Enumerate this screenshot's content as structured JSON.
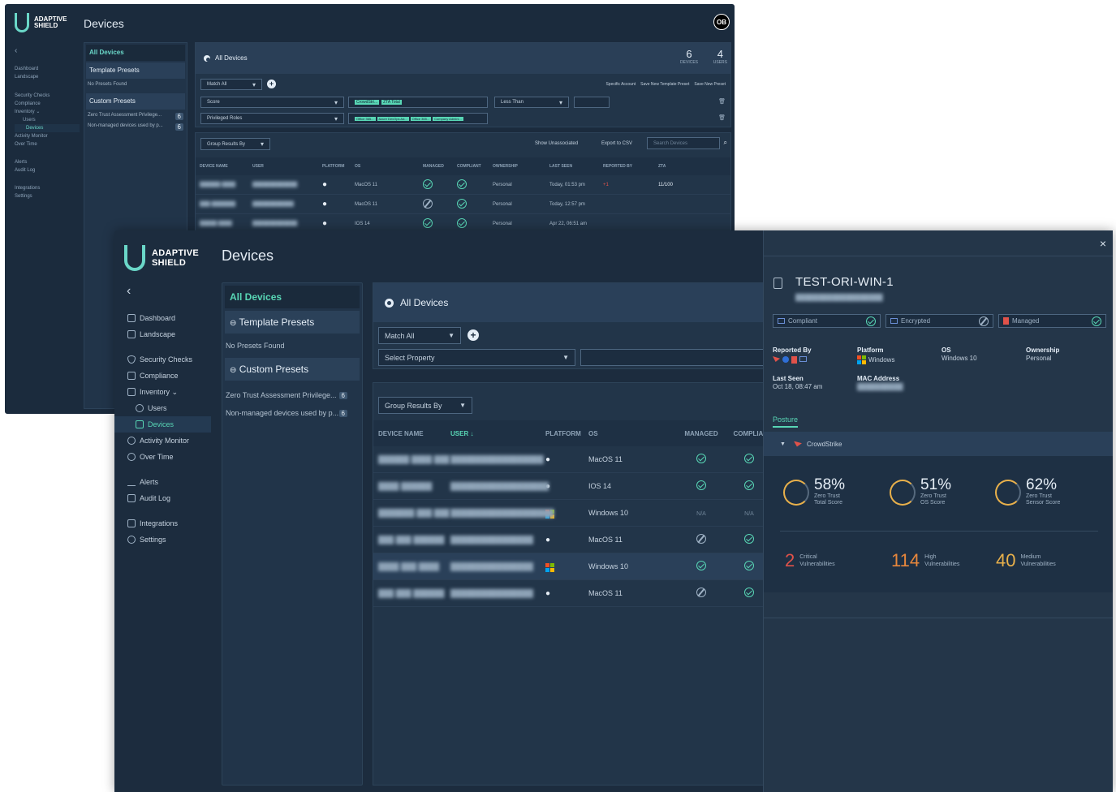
{
  "back": {
    "brand": [
      "ADAPTIVE",
      "SHIELD"
    ],
    "title": "Devices",
    "avatar": "OB",
    "nav": [
      "Dashboard",
      "Landscape",
      "Security Checks",
      "Compliance",
      "Inventory ⌄",
      "Users",
      "Devices",
      "Activity Monitor",
      "Over Time",
      "Alerts",
      "Audit Log",
      "Integrations",
      "Settings"
    ],
    "panel": {
      "all": "All Devices",
      "template": "Template Presets",
      "no_presets": "No Presets Found",
      "custom": "Custom Presets",
      "preset1": "Zero Trust Assessment Privilege...",
      "preset2": "Non-managed devices used by p...",
      "count": "6"
    },
    "main": {
      "title": "All Devices",
      "devices_count": "6",
      "devices_label": "DEVICES",
      "users_count": "4",
      "users_label": "USERS",
      "match": "Match All",
      "specific": "Specific Account",
      "save_template": "Save New Template Preset",
      "save_preset": "Save New Preset",
      "f1": "Score",
      "f2": "Privileged Roles",
      "op": "Less Than",
      "chips1": [
        "CrowdStri...",
        "ZTA Total"
      ],
      "chips2": [
        "Office 365...",
        "Azure DevOps Ad...",
        "Office 365...",
        "Company Admini..."
      ]
    },
    "table": {
      "group": "Group Results By",
      "show": "Show Unassociated",
      "export": "Export to CSV",
      "search": "Search Devices",
      "headers": [
        "DEVICE NAME",
        "USER",
        "PLATFORM",
        "OS",
        "MANAGED",
        "COMPLIANT",
        "OWNERSHIP",
        "LAST SEEN",
        "REPORTED BY",
        "ZTA"
      ],
      "rows": [
        {
          "os": "MacOS 11",
          "owner": "Personal",
          "seen": "Today, 01:53 pm",
          "zta": "11/100",
          "more": "+1"
        },
        {
          "os": "MacOS 11",
          "owner": "Personal",
          "seen": "Today, 12:57 pm"
        },
        {
          "os": "IOS 14",
          "owner": "Personal",
          "seen": "Apr 22, 06:51 am"
        }
      ]
    }
  },
  "front": {
    "brand": [
      "ADAPTIVE",
      "SHIELD"
    ],
    "title": "Devices",
    "back_icon": "chevron-left-icon",
    "nav": {
      "dashboard": "Dashboard",
      "landscape": "Landscape",
      "security": "Security Checks",
      "compliance": "Compliance",
      "inventory": "Inventory ⌄",
      "users": "Users",
      "devices": "Devices",
      "activity": "Activity Monitor",
      "overtime": "Over Time",
      "alerts": "Alerts",
      "audit": "Audit Log",
      "integrations": "Integrations",
      "settings": "Settings"
    },
    "panel": {
      "all": "All Devices",
      "template": "Template Presets",
      "no_presets": "No Presets Found",
      "custom": "Custom Presets",
      "preset1": "Zero Trust Assessment Privilege...",
      "preset1_count": "6",
      "preset2": "Non-managed devices used by p...",
      "preset2_count": "6"
    },
    "main": {
      "title": "All Devices",
      "match": "Match All",
      "property": "Select Property"
    },
    "table": {
      "group": "Group Results By",
      "headers": {
        "device": "DEVICE NAME",
        "user": "USER ↓",
        "platform": "PLATFORM",
        "os": "OS",
        "managed": "MANAGED",
        "compliant": "COMPLIAI"
      },
      "rows": [
        {
          "os": "MacOS 11",
          "platform": "apple",
          "managed": "yes",
          "compliant": "yes"
        },
        {
          "os": "IOS 14",
          "platform": "apple",
          "managed": "yes",
          "compliant": "yes"
        },
        {
          "os": "Windows 10",
          "platform": "windows",
          "managed": "N/A",
          "compliant": "N/A"
        },
        {
          "os": "MacOS 11",
          "platform": "apple",
          "managed": "no",
          "compliant": "yes"
        },
        {
          "os": "Windows 10",
          "platform": "windows",
          "managed": "yes",
          "compliant": "yes"
        },
        {
          "os": "MacOS 11",
          "platform": "apple",
          "managed": "no",
          "compliant": "yes"
        }
      ]
    },
    "detail": {
      "close": "×",
      "device_name": "TEST-ORI-WIN-1",
      "chips": {
        "compliant": "Compliant",
        "encrypted": "Encrypted",
        "managed": "Managed"
      },
      "reported_by_label": "Reported By",
      "platform_label": "Platform",
      "platform_value": "Windows",
      "os_label": "OS",
      "os_value": "Windows 10",
      "ownership_label": "Ownership",
      "ownership_value": "Personal",
      "last_seen_label": "Last Seen",
      "last_seen_value": "Oct 18, 08:47 am",
      "mac_label": "MAC Address",
      "posture_tab": "Posture",
      "source": "CrowdStrike",
      "scores": [
        {
          "pct": "58%",
          "l1": "Zero Trust",
          "l2": "Total Score"
        },
        {
          "pct": "51%",
          "l1": "Zero Trust",
          "l2": "OS Score"
        },
        {
          "pct": "62%",
          "l1": "Zero Trust",
          "l2": "Sensor Score"
        }
      ],
      "vulns": [
        {
          "n": "2",
          "l1": "Critical",
          "l2": "Vulnerabilities",
          "color": "#e0524a"
        },
        {
          "n": "114",
          "l1": "High",
          "l2": "Vulnerabilities",
          "color": "#e8873c"
        },
        {
          "n": "40",
          "l1": "Medium",
          "l2": "Vulnerabilities",
          "color": "#e8b04b"
        }
      ]
    }
  },
  "colors": {
    "accent": "#58d6b5",
    "bg": "#1c2c3e",
    "panel": "#223549"
  }
}
